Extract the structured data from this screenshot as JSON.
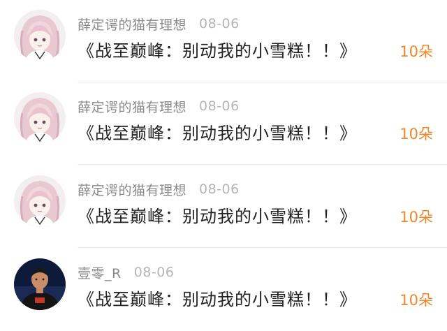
{
  "gift_list": {
    "items": [
      {
        "username": "薛定谔的猫有理想",
        "time": "08-06",
        "gift": "《战至巅峰：别动我的小雪糕！！》",
        "count": "10朵",
        "avatar": "anime-girl-avatar"
      },
      {
        "username": "薛定谔的猫有理想",
        "time": "08-06",
        "gift": "《战至巅峰：别动我的小雪糕！！》",
        "count": "10朵",
        "avatar": "anime-girl-avatar"
      },
      {
        "username": "薛定谔的猫有理想",
        "time": "08-06",
        "gift": "《战至巅峰：别动我的小雪糕！！》",
        "count": "10朵",
        "avatar": "anime-girl-avatar"
      },
      {
        "username": "壹零_R",
        "time": "08-06",
        "gift": "《战至巅峰：别动我的小雪糕！！》",
        "count": "10朵",
        "avatar": "man-photo-avatar"
      }
    ]
  },
  "colors": {
    "count": "#f2852a",
    "username": "#8a8a8a",
    "time": "#b5b5b5",
    "gift": "#222222"
  }
}
